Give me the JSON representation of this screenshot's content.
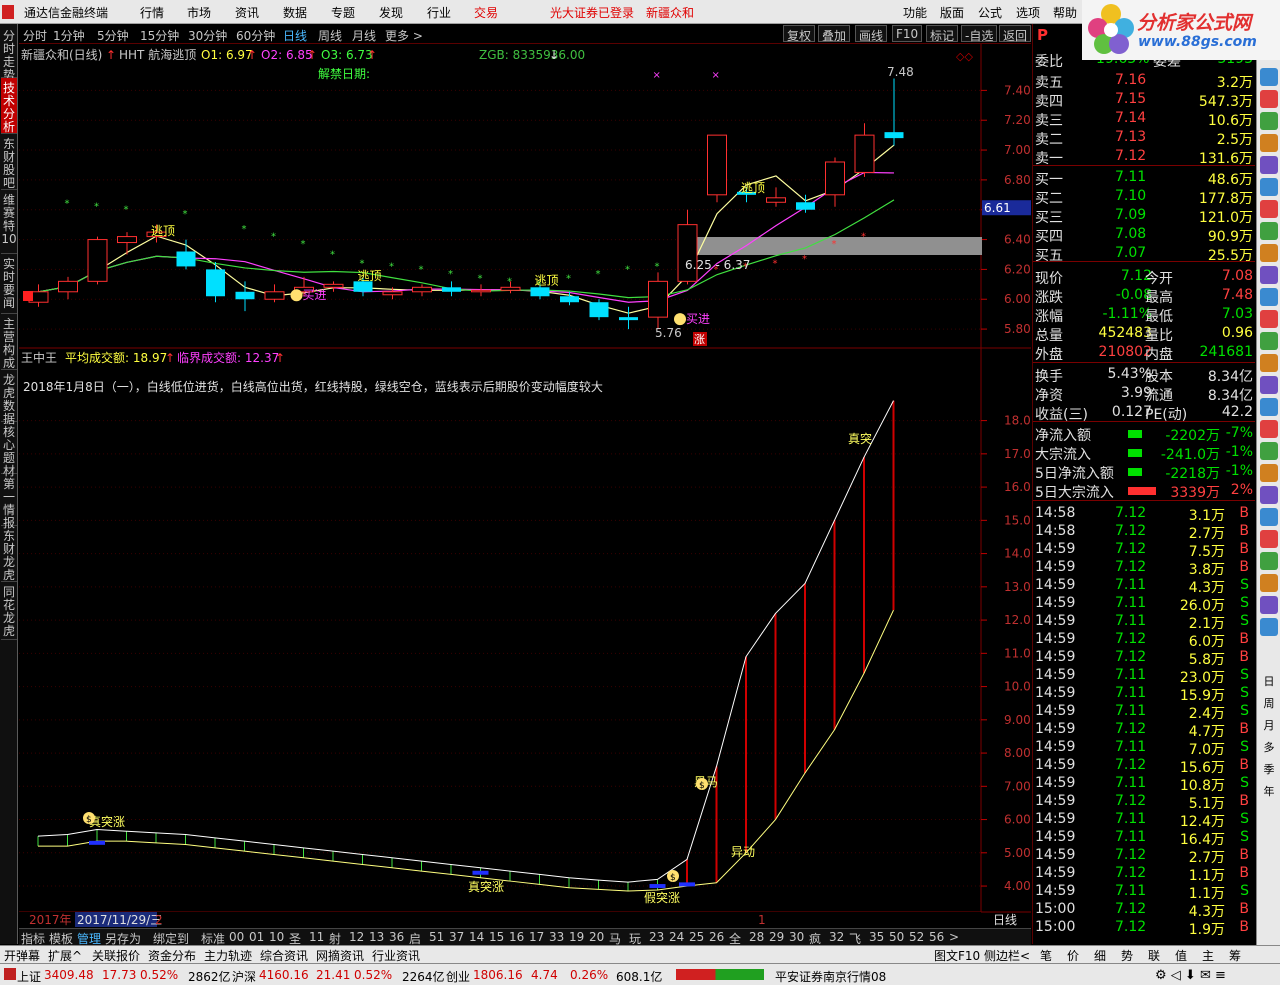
{
  "menu": {
    "app": "通达信金融终端",
    "items": [
      "行情",
      "市场",
      "资讯",
      "数据",
      "专题",
      "发现",
      "行业",
      "交易"
    ],
    "login": "光大证券已登录",
    "stock": "新疆众和",
    "right": [
      "功能",
      "版面",
      "公式",
      "选项",
      "帮助"
    ]
  },
  "logo": {
    "line1": "分析家公式网",
    "line2": "www.88gs.com",
    "sub": "新疆众和"
  },
  "leftbar": [
    "分时走势",
    "技术分析",
    "东财股吧",
    "维赛特10",
    "实时要闻",
    "主营构成",
    "龙虎数据",
    "核心题材",
    "第一情报",
    "东财龙虎",
    "同花龙虎"
  ],
  "period": {
    "items": [
      "分时",
      "1分钟",
      "5分钟",
      "15分钟",
      "30分钟",
      "60分钟",
      "日线",
      "周线",
      "月线",
      "更多 >"
    ],
    "selected": "日线",
    "buttons": [
      "复权",
      "叠加",
      "画线",
      "F10",
      "标记",
      "-自选",
      "返回"
    ]
  },
  "upper": {
    "title": "新疆众和(日线)",
    "indicator": "HHT 航海逃顶",
    "o1": "O1: 6.97",
    "o2": "O2: 6.85",
    "o3": "O3: 6.73",
    "zgb": "ZGB: 8335936.00",
    "unlock": "解禁日期:",
    "hi_label": "7.48",
    "lo_label": "5.76",
    "range": "6.25 - 6.37",
    "axis": [
      "7.40",
      "7.20",
      "7.00",
      "6.80",
      "6.60",
      "6.40",
      "6.20",
      "6.00",
      "5.80"
    ],
    "cur": "6.61",
    "sig_top": "逃顶",
    "sig_in": "买进",
    "zhang": "涨",
    "hai": "海"
  },
  "lower": {
    "title": "王中王",
    "avg": "平均成交额: 18.97",
    "crit": "临界成交额: 12.37",
    "desc": "2018年1月8日（一），白线低位进货，白线高位出货，红线持股，绿线空仓，蓝线表示后期股价变动幅度较大",
    "axis": [
      "18.00",
      "17.00",
      "16.00",
      "15.00",
      "14.00",
      "13.00",
      "12.00",
      "11.00",
      "10.00",
      "9.00",
      "8.00",
      "7.00",
      "6.00",
      "5.00",
      "4.00"
    ],
    "labels": {
      "zt1": "真突涨",
      "zt2": "真突涨",
      "jt": "假突涨",
      "hm": "黑马",
      "yd": "异动",
      "zt3": "真突"
    },
    "s": "$"
  },
  "dates": {
    "year": "2017年",
    "date": "2017/11/29/三",
    "two": "2",
    "one": "1",
    "period": "日线"
  },
  "quote": {
    "wb_label": "委比",
    "wb": "-19.63%",
    "wc_label": "委差",
    "wc": "-3193",
    "asks": [
      [
        "卖五",
        "7.16",
        "3.2万"
      ],
      [
        "卖四",
        "7.15",
        "547.3万"
      ],
      [
        "卖三",
        "7.14",
        "10.6万"
      ],
      [
        "卖二",
        "7.13",
        "2.5万"
      ],
      [
        "卖一",
        "7.12",
        "131.6万"
      ]
    ],
    "bids": [
      [
        "买一",
        "7.11",
        "48.6万"
      ],
      [
        "买二",
        "7.10",
        "177.8万"
      ],
      [
        "买三",
        "7.09",
        "121.0万"
      ],
      [
        "买四",
        "7.08",
        "90.9万"
      ],
      [
        "买五",
        "7.07",
        "25.5万"
      ]
    ],
    "stats": [
      [
        "现价",
        "7.12",
        "今开",
        "7.08"
      ],
      [
        "涨跌",
        "-0.08",
        "最高",
        "7.48"
      ],
      [
        "涨幅",
        "-1.11%",
        "最低",
        "7.03"
      ],
      [
        "总量",
        "452483",
        "量比",
        "0.96"
      ],
      [
        "外盘",
        "210802",
        "内盘",
        "241681"
      ],
      [
        "换手",
        "5.43%",
        "股本",
        "8.34亿"
      ],
      [
        "净资",
        "3.99",
        "流通",
        "8.34亿"
      ],
      [
        "收益(三)",
        "0.127",
        "PE(动)",
        "42.2"
      ]
    ],
    "flows": [
      [
        "净流入额",
        "-2202万",
        "-7%"
      ],
      [
        "大宗流入",
        "-241.0万",
        "-1%"
      ],
      [
        "5日净流入额",
        "-2218万",
        "-1%"
      ],
      [
        "5日大宗流入",
        "3339万",
        "2%"
      ]
    ],
    "ticks": [
      [
        "14:58",
        "7.12",
        "3.1万",
        "B"
      ],
      [
        "14:58",
        "7.12",
        "2.7万",
        "B"
      ],
      [
        "14:59",
        "7.12",
        "7.5万",
        "B"
      ],
      [
        "14:59",
        "7.12",
        "3.8万",
        "B"
      ],
      [
        "14:59",
        "7.11",
        "4.3万",
        "S"
      ],
      [
        "14:59",
        "7.11",
        "26.0万",
        "S"
      ],
      [
        "14:59",
        "7.11",
        "2.1万",
        "S"
      ],
      [
        "14:59",
        "7.12",
        "6.0万",
        "B"
      ],
      [
        "14:59",
        "7.12",
        "5.8万",
        "B"
      ],
      [
        "14:59",
        "7.11",
        "23.0万",
        "S"
      ],
      [
        "14:59",
        "7.11",
        "15.9万",
        "S"
      ],
      [
        "14:59",
        "7.11",
        "2.4万",
        "S"
      ],
      [
        "14:59",
        "7.12",
        "4.7万",
        "B"
      ],
      [
        "14:59",
        "7.11",
        "7.0万",
        "S"
      ],
      [
        "14:59",
        "7.12",
        "15.6万",
        "B"
      ],
      [
        "14:59",
        "7.11",
        "10.8万",
        "S"
      ],
      [
        "14:59",
        "7.12",
        "5.1万",
        "B"
      ],
      [
        "14:59",
        "7.11",
        "12.4万",
        "S"
      ],
      [
        "14:59",
        "7.11",
        "16.4万",
        "S"
      ],
      [
        "14:59",
        "7.12",
        "2.7万",
        "B"
      ],
      [
        "14:59",
        "7.12",
        "1.1万",
        "B"
      ],
      [
        "14:59",
        "7.11",
        "1.1万",
        "S"
      ],
      [
        "15:00",
        "7.12",
        "4.3万",
        "B"
      ],
      [
        "15:00",
        "7.12",
        "1.9万",
        "B"
      ]
    ]
  },
  "rightbar": [
    "P",
    "",
    "",
    "",
    "",
    "",
    "",
    "",
    "",
    "",
    "",
    "",
    "",
    "",
    "",
    "",
    "",
    "",
    "",
    "",
    "",
    "",
    "",
    "",
    "",
    "",
    "",
    "",
    "",
    "",
    "",
    "",
    "",
    "",
    "",
    "日",
    "周",
    "月",
    "多",
    "季",
    "年"
  ],
  "bottomtabs": [
    "指标",
    "模板",
    "管理",
    "另存为",
    "绑定到",
    "标准",
    "00",
    "01",
    "10",
    "圣",
    "11",
    "射",
    "12",
    "13",
    "36",
    "启",
    "51",
    "37",
    "14",
    "15",
    "16",
    "17",
    "33",
    "19",
    "20",
    "马",
    "玩",
    "23",
    "24",
    "25",
    "26",
    "全",
    "28",
    "29",
    "30",
    "疯",
    "32",
    "飞",
    "35",
    "50",
    "52",
    "56",
    ">"
  ],
  "funcbar": [
    "开弹幕",
    "扩展^",
    "关联报价",
    "资金分布",
    "主力轨迹",
    "综合资讯",
    "网摘资讯",
    "行业资讯",
    "图文F10",
    "侧边栏<"
  ],
  "funcbar_right": [
    "笔",
    "价",
    "细",
    "势",
    "联",
    "值",
    "主",
    "筹"
  ],
  "status": {
    "sh": "上证",
    "sh_v": "3409.48",
    "sh_c": "17.73",
    "sh_p": "0.52%",
    "sh_a": "2862亿",
    "hs": "沪深",
    "hs_v": "4160.16",
    "hs_c": "21.41",
    "hs_p": "0.52%",
    "hs_a": "2264亿",
    "cy": "创业",
    "cy_v": "1806.16",
    "cy_c": "4.74",
    "cy_p": "0.26%",
    "cy_a": "608.1亿",
    "broker": "平安证券南京行情08"
  },
  "chart_data": {
    "type": "candlestick",
    "note": "daily K-line with MA and indicator panel",
    "candles": [
      [
        5.98,
        6.05,
        6.1,
        5.95
      ],
      [
        6.05,
        6.12,
        6.15,
        6.0
      ],
      [
        6.12,
        6.4,
        6.42,
        6.1
      ],
      [
        6.38,
        6.42,
        6.45,
        6.3
      ],
      [
        6.42,
        6.45,
        6.5,
        6.38
      ],
      [
        6.32,
        6.22,
        6.4,
        6.2
      ],
      [
        6.2,
        6.02,
        6.25,
        5.98
      ],
      [
        6.05,
        6.0,
        6.12,
        5.92
      ],
      [
        6.0,
        6.05,
        6.1,
        5.98
      ],
      [
        6.05,
        6.08,
        6.15,
        6.02
      ],
      [
        6.08,
        6.1,
        6.12,
        6.05
      ],
      [
        6.12,
        6.05,
        6.15,
        6.02
      ],
      [
        6.03,
        6.05,
        6.08,
        6.0
      ],
      [
        6.05,
        6.08,
        6.1,
        6.02
      ],
      [
        6.08,
        6.05,
        6.12,
        6.02
      ],
      [
        6.05,
        6.06,
        6.1,
        6.02
      ],
      [
        6.06,
        6.08,
        6.12,
        6.04
      ],
      [
        6.08,
        6.02,
        6.1,
        6.0
      ],
      [
        6.02,
        5.98,
        6.05,
        5.96
      ],
      [
        5.98,
        5.88,
        6.0,
        5.86
      ],
      [
        5.88,
        5.86,
        5.95,
        5.8
      ],
      [
        5.88,
        6.12,
        6.18,
        5.8
      ],
      [
        6.12,
        6.5,
        6.6,
        6.1
      ],
      [
        6.7,
        7.1,
        7.1,
        6.65
      ],
      [
        6.72,
        6.7,
        6.75,
        6.65
      ],
      [
        6.65,
        6.68,
        6.75,
        6.62
      ],
      [
        6.65,
        6.6,
        6.7,
        6.58
      ],
      [
        6.7,
        6.92,
        6.95,
        6.62
      ],
      [
        6.85,
        7.1,
        7.18,
        6.82
      ],
      [
        7.12,
        7.08,
        7.48,
        7.03
      ]
    ]
  }
}
